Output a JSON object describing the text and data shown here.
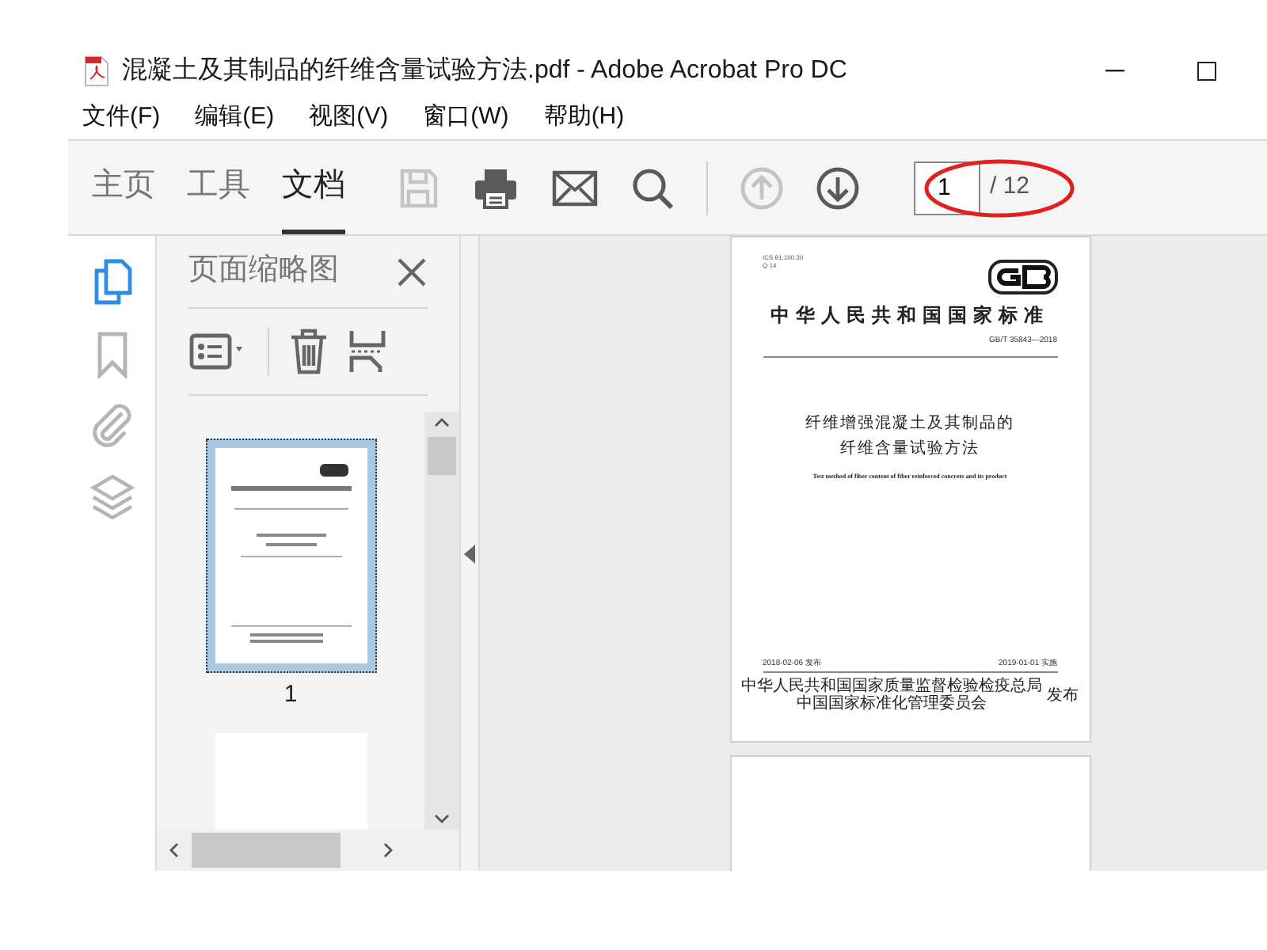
{
  "window": {
    "title": "混凝土及其制品的纤维含量试验方法.pdf - Adobe Acrobat Pro DC"
  },
  "menu": [
    "文件(F)",
    "编辑(E)",
    "视图(V)",
    "窗口(W)",
    "帮助(H)"
  ],
  "tabs": [
    {
      "label": "主页",
      "selected": false
    },
    {
      "label": "工具",
      "selected": false
    },
    {
      "label": "文档",
      "selected": true
    }
  ],
  "toolbar": [
    {
      "kind": "save",
      "disabled": true
    },
    {
      "kind": "print",
      "disabled": false
    },
    {
      "kind": "email",
      "disabled": false
    },
    {
      "kind": "search",
      "disabled": false
    },
    {
      "kind": "up",
      "disabled": true
    },
    {
      "kind": "down",
      "disabled": false
    }
  ],
  "page_nav": {
    "value": "1",
    "total": "/ 12"
  },
  "side_rail": [
    {
      "kind": "pages",
      "selected": true
    },
    {
      "kind": "bookmark",
      "selected": false
    },
    {
      "kind": "attachment",
      "selected": false
    },
    {
      "kind": "layers",
      "selected": false
    }
  ],
  "thumbnail_panel": {
    "title": "页面缩略图",
    "thumbnails": [
      {
        "kind": "rendered",
        "label": "1",
        "selected": true
      },
      {
        "kind": "blank",
        "selected": false
      }
    ]
  },
  "document": {
    "codes": [
      "ICS 91.100.30",
      "Q 14"
    ],
    "standard_title": "中华人民共和国国家标准",
    "number": "GB/T 35843—2018",
    "title_lines": [
      "纤维增强混凝土及其制品的",
      "纤维含量试验方法"
    ],
    "english_title": "Test method of fiber content of fiber reinforced concrete and its product",
    "issue_date": "2018-02-06 发布",
    "effective_date": "2019-01-01 实施",
    "issuers": [
      "中华人民共和国国家质量监督检验检疫总局",
      "中国国家标准化管理委员会"
    ],
    "issue_word": "发布"
  }
}
